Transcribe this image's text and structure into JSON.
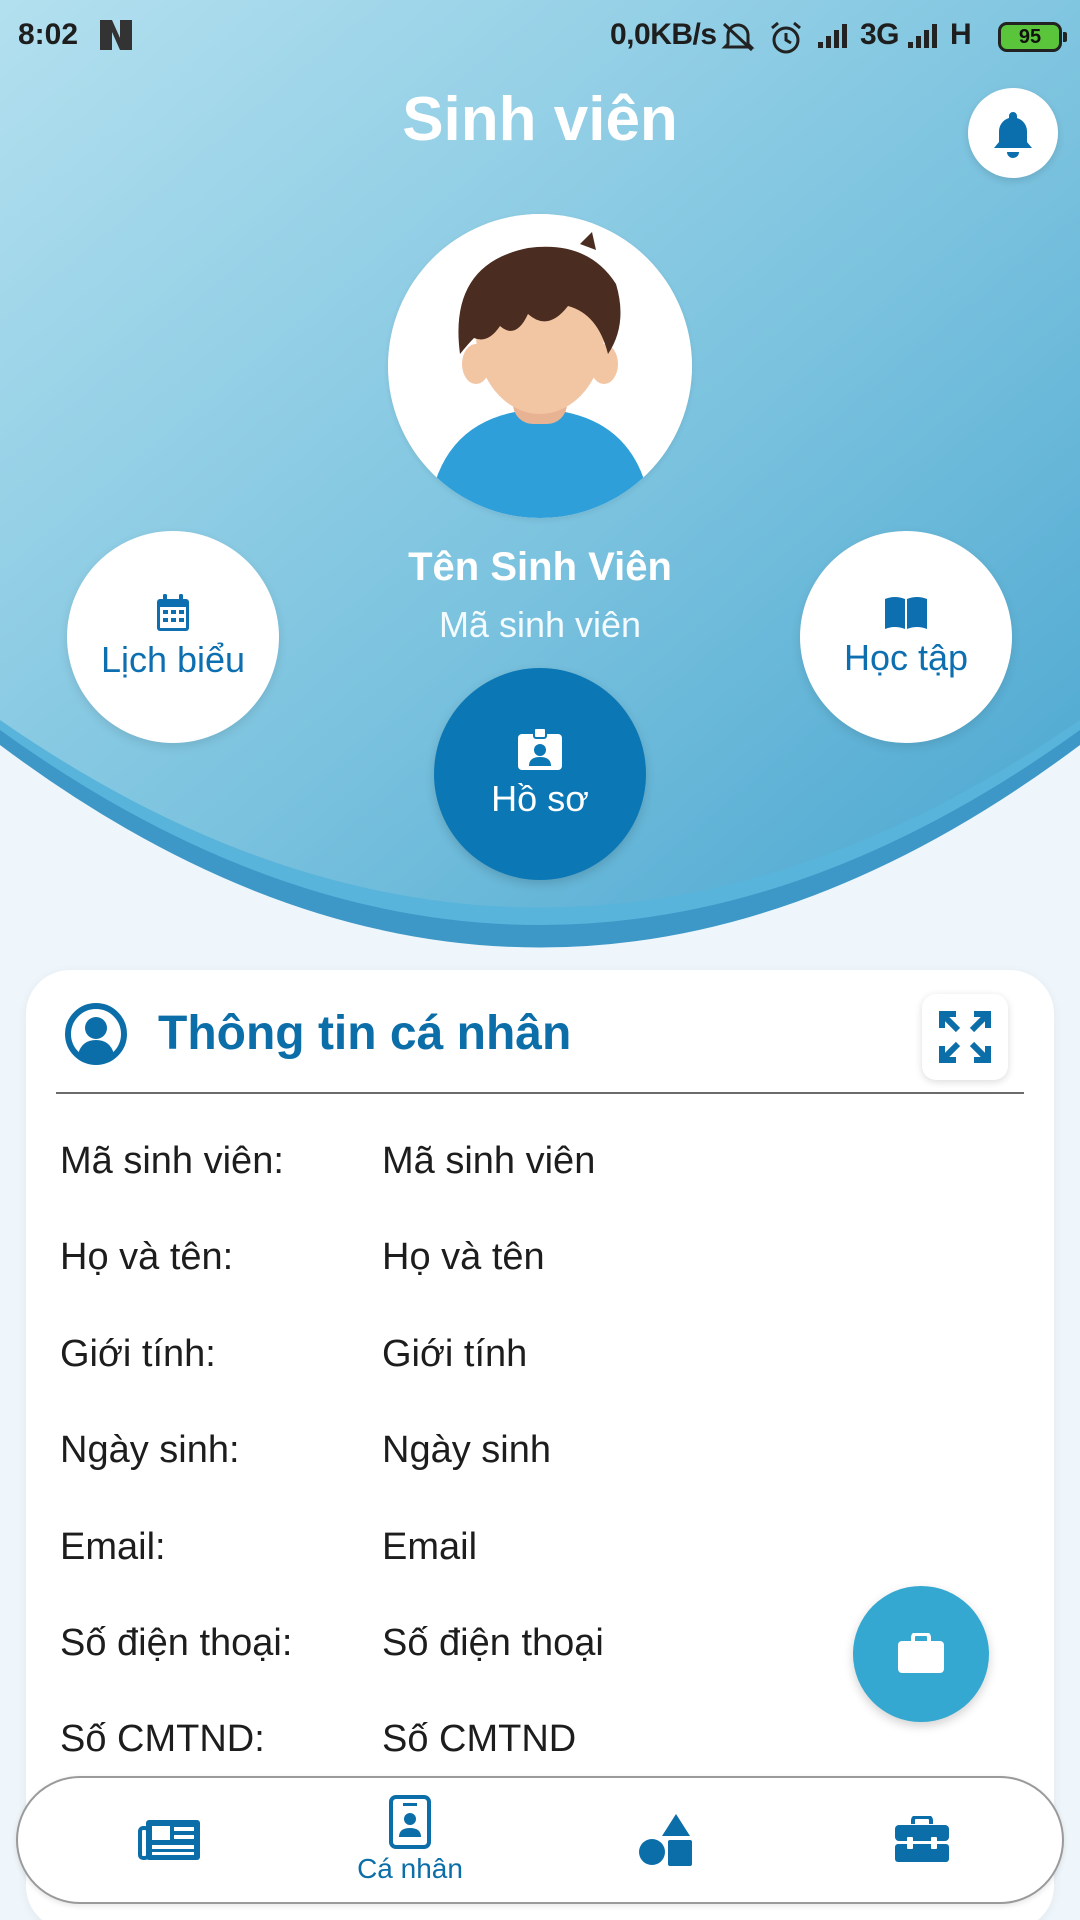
{
  "status_bar": {
    "time": "8:02",
    "network_speed": "0,0KB/s",
    "net_3g": "3G",
    "net_h": "H",
    "battery": "95"
  },
  "header": {
    "title": "Sinh viên"
  },
  "profile": {
    "name": "Tên Sinh Viên",
    "id": "Mã sinh viên"
  },
  "actions": {
    "schedule_label": "Lịch biểu",
    "study_label": "Học tập",
    "profile_label": "Hồ sơ"
  },
  "card": {
    "title": "Thông tin cá nhân",
    "rows": [
      {
        "label": "Mã sinh viên:",
        "value": "Mã sinh viên"
      },
      {
        "label": "Họ và tên:",
        "value": "Họ và tên"
      },
      {
        "label": "Giới tính:",
        "value": "Giới tính"
      },
      {
        "label": "Ngày sinh:",
        "value": "Ngày sinh"
      },
      {
        "label": "Email:",
        "value": "Email"
      },
      {
        "label": "Số điện thoại:",
        "value": "Số điện thoại"
      },
      {
        "label": "Số CMTND:",
        "value": "Số CMTND"
      }
    ]
  },
  "bottom_nav": {
    "items": [
      {
        "icon": "newspaper-icon",
        "label": ""
      },
      {
        "icon": "id-badge-icon",
        "label": "Cá nhân"
      },
      {
        "icon": "shapes-icon",
        "label": ""
      },
      {
        "icon": "toolbox-icon",
        "label": ""
      }
    ]
  },
  "colors": {
    "primary": "#0c6ea9",
    "hero_light": "#a7d8ea",
    "hero_dark": "#4fa9d2",
    "fab": "#34a8d0"
  }
}
